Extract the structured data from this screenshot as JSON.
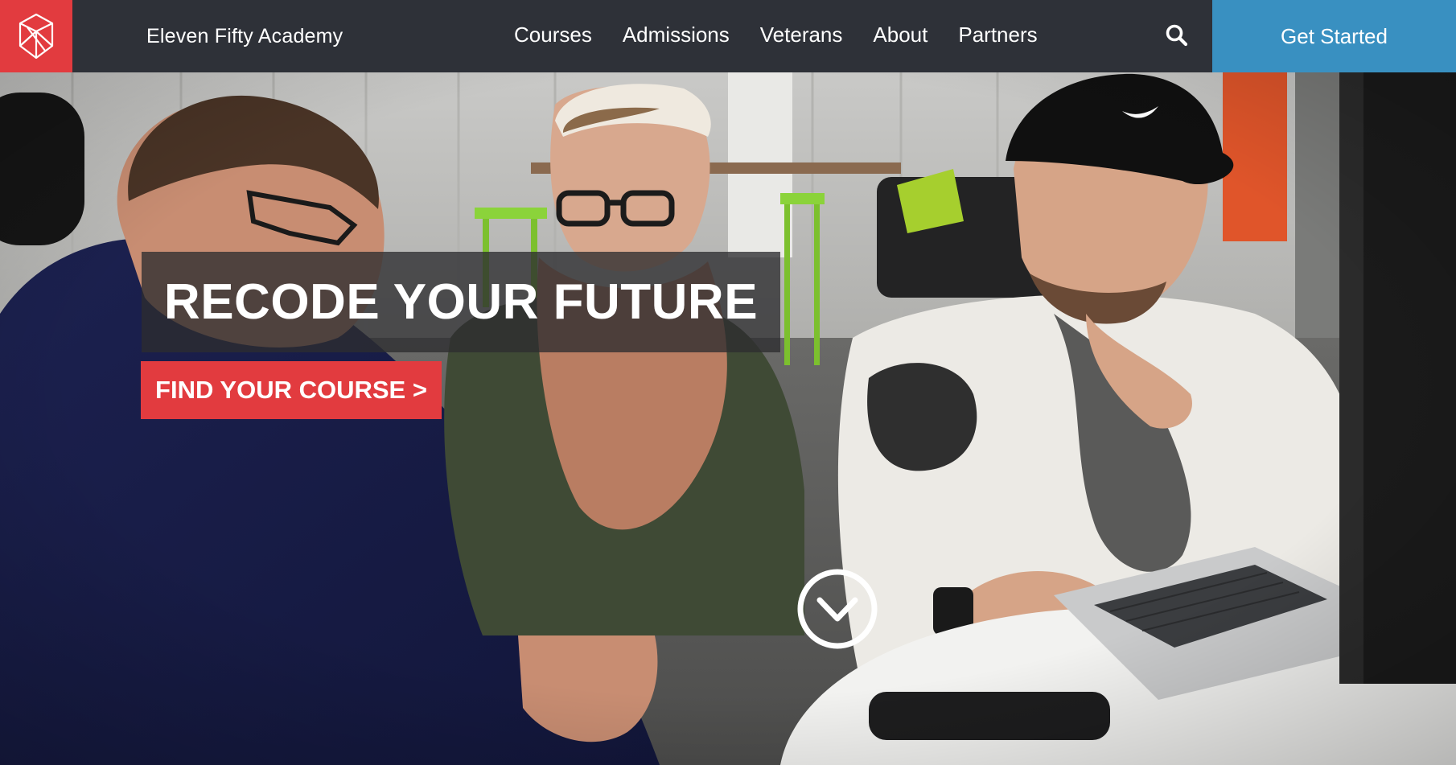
{
  "header": {
    "logo_icon": "geometric-shield-logo",
    "brand_name": "Eleven Fifty Academy",
    "nav": [
      {
        "label": "Courses"
      },
      {
        "label": "Admissions"
      },
      {
        "label": "Veterans"
      },
      {
        "label": "About"
      },
      {
        "label": "Partners"
      }
    ],
    "search_icon": "search-icon",
    "cta_label": "Get Started"
  },
  "hero": {
    "headline": "RECODE YOUR FUTURE",
    "course_button": "FIND YOUR COURSE >",
    "scroll_icon": "chevron-down-circle-icon"
  },
  "colors": {
    "nav_background": "#2e3138",
    "brand_red": "#e23b3f",
    "cta_blue": "#3990c1",
    "headline_overlay": "#2d2d30"
  }
}
